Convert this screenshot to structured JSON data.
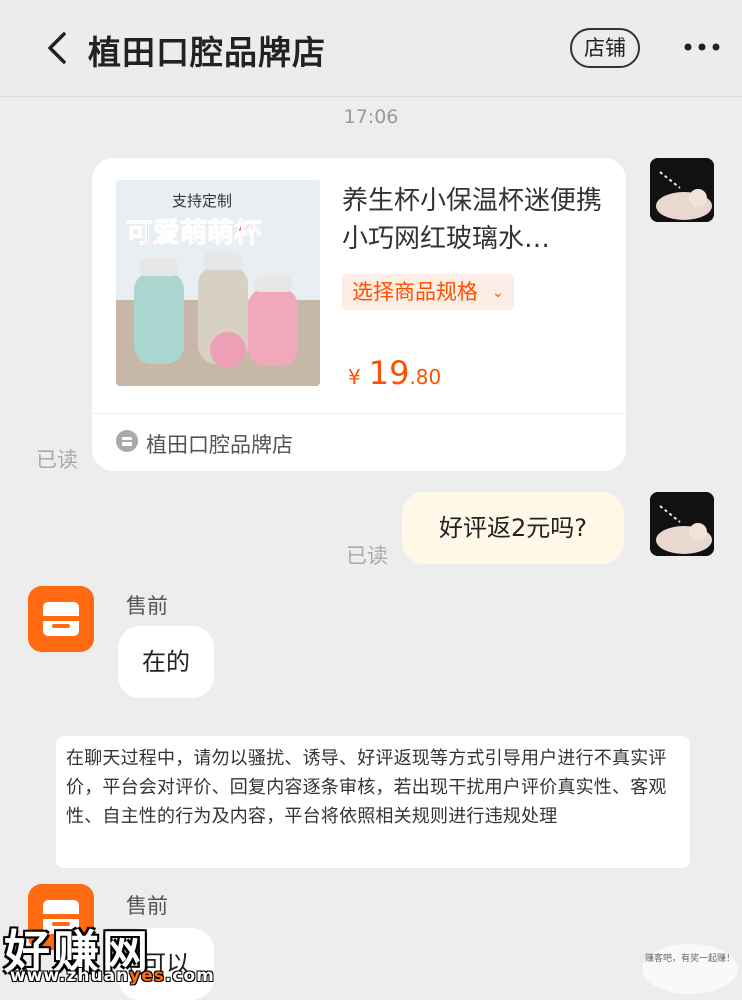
{
  "header": {
    "title": "植田口腔品牌店",
    "shop_button": "店铺",
    "back_icon": "chevron-left-icon",
    "more_icon": "more-dots-icon"
  },
  "timestamp": "17:06",
  "product_card": {
    "image_text_top": "支持定制",
    "image_text_main": "可爱萌萌杯",
    "name": "养生杯小保温杯迷便携小巧网红玻璃水…",
    "spec_label": "选择商品规格",
    "price_symbol": "¥",
    "price_int": "19",
    "price_dec": ".80",
    "shop_name": "植田口腔品牌店"
  },
  "messages": {
    "read_label_1": "已读",
    "read_label_2": "已读",
    "user_text": "好评返2元吗?",
    "sender_1": "售前",
    "shop_text": "在的",
    "sender_2": "售前",
    "shop_text_2": "可以"
  },
  "notice": "在聊天过程中，请勿以骚扰、诱导、好评返现等方式引导用户进行不真实评价，平台会对评价、回复内容逐条审核，若出现干扰用户评价真实性、客观性、自主性的行为及内容，平台将依照相关规则进行违规处理",
  "watermark": {
    "main": "好赚网",
    "url_prefix": "www.zhuan",
    "url_em": "yes",
    "url_suffix": ".com",
    "corner": "赚客吧，有奖一起赚！"
  },
  "colors": {
    "accent": "#ff5000",
    "shop_avatar": "#ff6a12",
    "user_bubble": "#fff8e6",
    "background": "#ededed"
  }
}
